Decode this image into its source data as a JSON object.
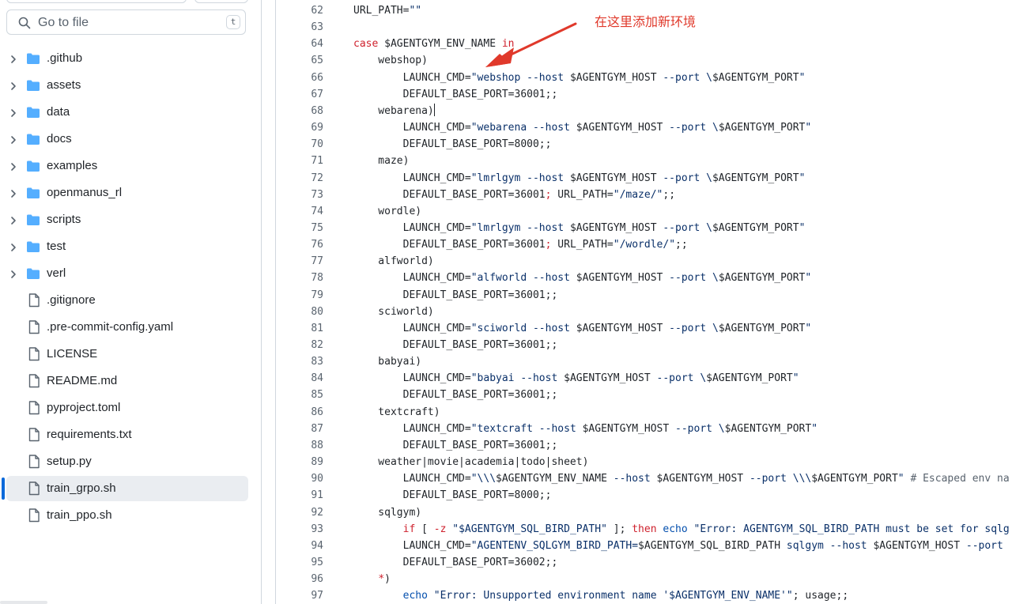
{
  "search": {
    "placeholder": "Go to file",
    "shortcut": "t"
  },
  "tree": [
    {
      "type": "folder",
      "name": ".github",
      "icon": "folder-icon"
    },
    {
      "type": "folder",
      "name": "assets",
      "icon": "folder-icon"
    },
    {
      "type": "folder",
      "name": "data",
      "icon": "folder-icon"
    },
    {
      "type": "folder",
      "name": "docs",
      "icon": "folder-icon"
    },
    {
      "type": "folder",
      "name": "examples",
      "icon": "folder-icon"
    },
    {
      "type": "folder",
      "name": "openmanus_rl",
      "icon": "folder-icon"
    },
    {
      "type": "folder",
      "name": "scripts",
      "icon": "folder-icon"
    },
    {
      "type": "folder",
      "name": "test",
      "icon": "folder-icon"
    },
    {
      "type": "folder",
      "name": "verl",
      "icon": "folder-icon"
    },
    {
      "type": "file",
      "name": ".gitignore",
      "icon": "file-icon"
    },
    {
      "type": "file",
      "name": ".pre-commit-config.yaml",
      "icon": "file-icon"
    },
    {
      "type": "file",
      "name": "LICENSE",
      "icon": "file-icon"
    },
    {
      "type": "file",
      "name": "README.md",
      "icon": "file-icon"
    },
    {
      "type": "file",
      "name": "pyproject.toml",
      "icon": "file-icon"
    },
    {
      "type": "file",
      "name": "requirements.txt",
      "icon": "file-icon"
    },
    {
      "type": "file",
      "name": "setup.py",
      "icon": "file-icon"
    },
    {
      "type": "file",
      "name": "train_grpo.sh",
      "icon": "file-icon",
      "selected": true
    },
    {
      "type": "file",
      "name": "train_ppo.sh",
      "icon": "file-icon"
    }
  ],
  "annotation": {
    "text": "在这里添加新环境",
    "color": "#e0392b"
  },
  "colors": {
    "keyword": "#cf222e",
    "string": "#0a3069",
    "builtin": "#0550ae",
    "comment": "#59636e",
    "accent": "#0969da"
  },
  "code": [
    {
      "n": "62",
      "t": [
        [
          "plain",
          "URL_PATH="
        ],
        [
          "string",
          "\"\""
        ]
      ]
    },
    {
      "n": "63",
      "t": []
    },
    {
      "n": "64",
      "t": [
        [
          "keyword",
          "case"
        ],
        [
          "plain",
          " $AGENTGYM_ENV_NAME "
        ],
        [
          "keyword",
          "in"
        ]
      ]
    },
    {
      "n": "65",
      "t": [
        [
          "plain",
          "    webshop)"
        ]
      ]
    },
    {
      "n": "66",
      "t": [
        [
          "plain",
          "        LAUNCH_CMD="
        ],
        [
          "string",
          "\"webshop --host "
        ],
        [
          "plain",
          "$AGENTGYM_HOST"
        ],
        [
          "string",
          " --port \\"
        ],
        [
          "plain",
          "$AGENTGYM_PORT"
        ],
        [
          "string",
          "\""
        ]
      ]
    },
    {
      "n": "67",
      "t": [
        [
          "plain",
          "        DEFAULT_BASE_PORT=36001;;"
        ]
      ]
    },
    {
      "n": "68",
      "t": [
        [
          "plain",
          "    webarena)"
        ],
        [
          "caret",
          ""
        ]
      ]
    },
    {
      "n": "69",
      "t": [
        [
          "plain",
          "        LAUNCH_CMD="
        ],
        [
          "string",
          "\"webarena --host "
        ],
        [
          "plain",
          "$AGENTGYM_HOST"
        ],
        [
          "string",
          " --port \\"
        ],
        [
          "plain",
          "$AGENTGYM_PORT"
        ],
        [
          "string",
          "\""
        ]
      ]
    },
    {
      "n": "70",
      "t": [
        [
          "plain",
          "        DEFAULT_BASE_PORT=8000;;"
        ]
      ]
    },
    {
      "n": "71",
      "t": [
        [
          "plain",
          "    maze)"
        ]
      ]
    },
    {
      "n": "72",
      "t": [
        [
          "plain",
          "        LAUNCH_CMD="
        ],
        [
          "string",
          "\"lmrlgym --host "
        ],
        [
          "plain",
          "$AGENTGYM_HOST"
        ],
        [
          "string",
          " --port \\"
        ],
        [
          "plain",
          "$AGENTGYM_PORT"
        ],
        [
          "string",
          "\""
        ]
      ]
    },
    {
      "n": "73",
      "t": [
        [
          "plain",
          "        DEFAULT_BASE_PORT=36001"
        ],
        [
          "keyword",
          ";"
        ],
        [
          "plain",
          " URL_PATH="
        ],
        [
          "string",
          "\"/maze/\""
        ],
        [
          "plain",
          ";;"
        ]
      ]
    },
    {
      "n": "74",
      "t": [
        [
          "plain",
          "    wordle)"
        ]
      ]
    },
    {
      "n": "75",
      "t": [
        [
          "plain",
          "        LAUNCH_CMD="
        ],
        [
          "string",
          "\"lmrlgym --host "
        ],
        [
          "plain",
          "$AGENTGYM_HOST"
        ],
        [
          "string",
          " --port \\"
        ],
        [
          "plain",
          "$AGENTGYM_PORT"
        ],
        [
          "string",
          "\""
        ]
      ]
    },
    {
      "n": "76",
      "t": [
        [
          "plain",
          "        DEFAULT_BASE_PORT=36001"
        ],
        [
          "keyword",
          ";"
        ],
        [
          "plain",
          " URL_PATH="
        ],
        [
          "string",
          "\"/wordle/\""
        ],
        [
          "plain",
          ";;"
        ]
      ]
    },
    {
      "n": "77",
      "t": [
        [
          "plain",
          "    alfworld)"
        ]
      ]
    },
    {
      "n": "78",
      "t": [
        [
          "plain",
          "        LAUNCH_CMD="
        ],
        [
          "string",
          "\"alfworld --host "
        ],
        [
          "plain",
          "$AGENTGYM_HOST"
        ],
        [
          "string",
          " --port \\"
        ],
        [
          "plain",
          "$AGENTGYM_PORT"
        ],
        [
          "string",
          "\""
        ]
      ]
    },
    {
      "n": "79",
      "t": [
        [
          "plain",
          "        DEFAULT_BASE_PORT=36001;;"
        ]
      ]
    },
    {
      "n": "80",
      "t": [
        [
          "plain",
          "    sciworld)"
        ]
      ]
    },
    {
      "n": "81",
      "t": [
        [
          "plain",
          "        LAUNCH_CMD="
        ],
        [
          "string",
          "\"sciworld --host "
        ],
        [
          "plain",
          "$AGENTGYM_HOST"
        ],
        [
          "string",
          " --port \\"
        ],
        [
          "plain",
          "$AGENTGYM_PORT"
        ],
        [
          "string",
          "\""
        ]
      ]
    },
    {
      "n": "82",
      "t": [
        [
          "plain",
          "        DEFAULT_BASE_PORT=36001;;"
        ]
      ]
    },
    {
      "n": "83",
      "t": [
        [
          "plain",
          "    babyai)"
        ]
      ]
    },
    {
      "n": "84",
      "t": [
        [
          "plain",
          "        LAUNCH_CMD="
        ],
        [
          "string",
          "\"babyai --host "
        ],
        [
          "plain",
          "$AGENTGYM_HOST"
        ],
        [
          "string",
          " --port \\"
        ],
        [
          "plain",
          "$AGENTGYM_PORT"
        ],
        [
          "string",
          "\""
        ]
      ]
    },
    {
      "n": "85",
      "t": [
        [
          "plain",
          "        DEFAULT_BASE_PORT=36001;;"
        ]
      ]
    },
    {
      "n": "86",
      "t": [
        [
          "plain",
          "    textcraft)"
        ]
      ]
    },
    {
      "n": "87",
      "t": [
        [
          "plain",
          "        LAUNCH_CMD="
        ],
        [
          "string",
          "\"textcraft --host "
        ],
        [
          "plain",
          "$AGENTGYM_HOST"
        ],
        [
          "string",
          " --port \\"
        ],
        [
          "plain",
          "$AGENTGYM_PORT"
        ],
        [
          "string",
          "\""
        ]
      ]
    },
    {
      "n": "88",
      "t": [
        [
          "plain",
          "        DEFAULT_BASE_PORT=36001;;"
        ]
      ]
    },
    {
      "n": "89",
      "t": [
        [
          "plain",
          "    weather|movie|academia|todo|sheet)"
        ]
      ]
    },
    {
      "n": "90",
      "t": [
        [
          "plain",
          "        LAUNCH_CMD="
        ],
        [
          "string",
          "\"\\\\\\"
        ],
        [
          "plain",
          "$AGENTGYM_ENV_NAME"
        ],
        [
          "string",
          " --host "
        ],
        [
          "plain",
          "$AGENTGYM_HOST"
        ],
        [
          "string",
          " --port \\\\\\"
        ],
        [
          "plain",
          "$AGENTGYM_PORT"
        ],
        [
          "string",
          "\""
        ],
        [
          "comment",
          " # Escaped env na"
        ]
      ]
    },
    {
      "n": "91",
      "t": [
        [
          "plain",
          "        DEFAULT_BASE_PORT=8000;;"
        ]
      ]
    },
    {
      "n": "92",
      "t": [
        [
          "plain",
          "    sqlgym)"
        ]
      ]
    },
    {
      "n": "93",
      "t": [
        [
          "plain",
          "        "
        ],
        [
          "keyword",
          "if"
        ],
        [
          "plain",
          " [ "
        ],
        [
          "keyword",
          "-z"
        ],
        [
          "plain",
          " "
        ],
        [
          "string",
          "\"$AGENTGYM_SQL_BIRD_PATH\""
        ],
        [
          "plain",
          " ]; "
        ],
        [
          "keyword",
          "then"
        ],
        [
          "plain",
          " "
        ],
        [
          "builtin",
          "echo"
        ],
        [
          "plain",
          " "
        ],
        [
          "string",
          "\"Error: AGENTGYM_SQL_BIRD_PATH must be set for sqlg"
        ]
      ]
    },
    {
      "n": "94",
      "t": [
        [
          "plain",
          "        LAUNCH_CMD="
        ],
        [
          "string",
          "\"AGENTENV_SQLGYM_BIRD_PATH="
        ],
        [
          "plain",
          "$AGENTGYM_SQL_BIRD_PATH"
        ],
        [
          "string",
          " sqlgym --host "
        ],
        [
          "plain",
          "$AGENTGYM_HOST"
        ],
        [
          "string",
          " --port"
        ]
      ]
    },
    {
      "n": "95",
      "t": [
        [
          "plain",
          "        DEFAULT_BASE_PORT=36002;;"
        ]
      ]
    },
    {
      "n": "96",
      "t": [
        [
          "plain",
          "    "
        ],
        [
          "keyword",
          "*"
        ],
        [
          "plain",
          ")"
        ]
      ]
    },
    {
      "n": "97",
      "t": [
        [
          "plain",
          "        "
        ],
        [
          "builtin",
          "echo"
        ],
        [
          "plain",
          " "
        ],
        [
          "string",
          "\"Error: Unsupported environment name '$AGENTGYM_ENV_NAME'\""
        ],
        [
          "plain",
          "; usage;;"
        ]
      ]
    }
  ]
}
